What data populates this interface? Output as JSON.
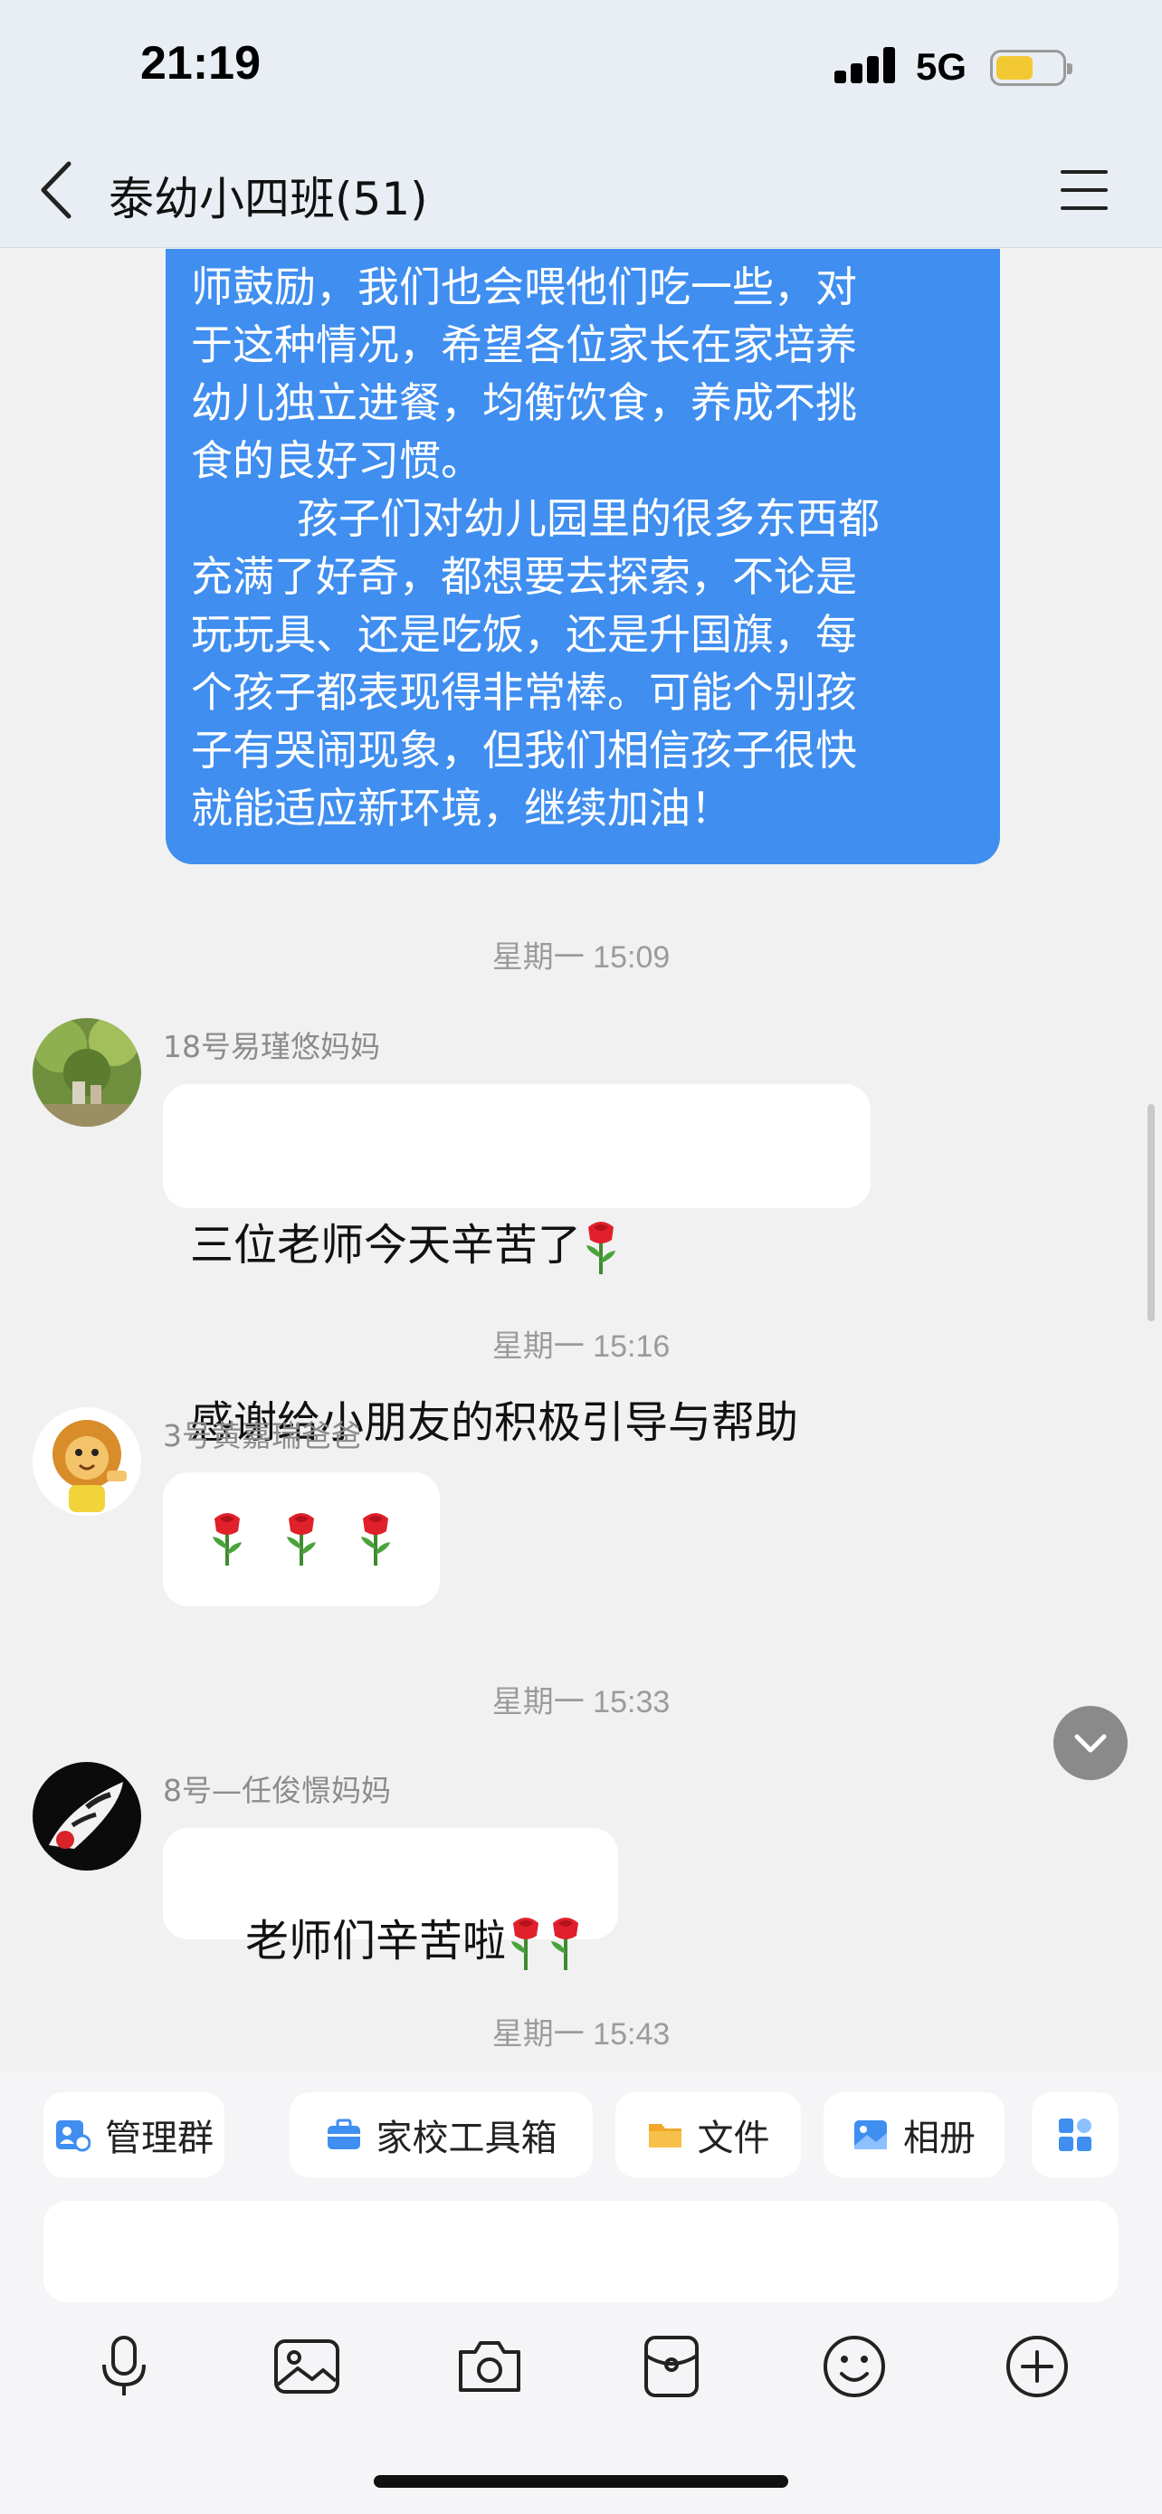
{
  "status_bar": {
    "time": "21:19",
    "network": "5G",
    "battery_level": 0.55
  },
  "header": {
    "title": "泰幼小四班(51)"
  },
  "teacher_message": {
    "text": "师鼓励，我们也会喂他们吃一些，对\n于这种情况，希望各位家长在家培养\n幼儿独立进餐，均衡饮食，养成不挑\n食的良好习惯。\n        孩子们对幼儿园里的很多东西都\n充满了好奇，都想要去探索，不论是\n玩玩具、还是吃饭，还是升国旗，每\n个孩子都表现得非常棒。可能个别孩\n子有哭闹现象，但我们相信孩子很快\n就能适应新环境，继续加油！"
  },
  "messages": [
    {
      "timestamp": "星期一 15:09",
      "sender": "18号易瑾悠妈妈",
      "line1": "三位老师今天辛苦了",
      "line2": "感谢给小朋友的积极引导与帮助"
    },
    {
      "timestamp": "星期一 15:16",
      "sender": "3号黄嘉瑞爸爸",
      "rose_count": 3
    },
    {
      "timestamp": "星期一 15:33",
      "sender": "8号—任俊憬妈妈",
      "text": "老师们辛苦啦"
    }
  ],
  "last_timestamp": "星期一 15:43",
  "quick_tools": [
    {
      "label": "管理群",
      "icon": "group-admin-icon"
    },
    {
      "label": "家校工具箱",
      "icon": "toolbox-icon"
    },
    {
      "label": "文件",
      "icon": "folder-icon"
    },
    {
      "label": "相册",
      "icon": "album-icon"
    },
    {
      "label": "",
      "icon": "apps-icon"
    }
  ],
  "input": {
    "value": ""
  },
  "input_icons": [
    "microphone-icon",
    "image-icon",
    "camera-icon",
    "red-packet-icon",
    "emoji-icon",
    "plus-icon"
  ],
  "colors": {
    "teacher_bubble": "#3f8ef0",
    "background": "#f1f1f1",
    "header": "#e9eef4"
  }
}
